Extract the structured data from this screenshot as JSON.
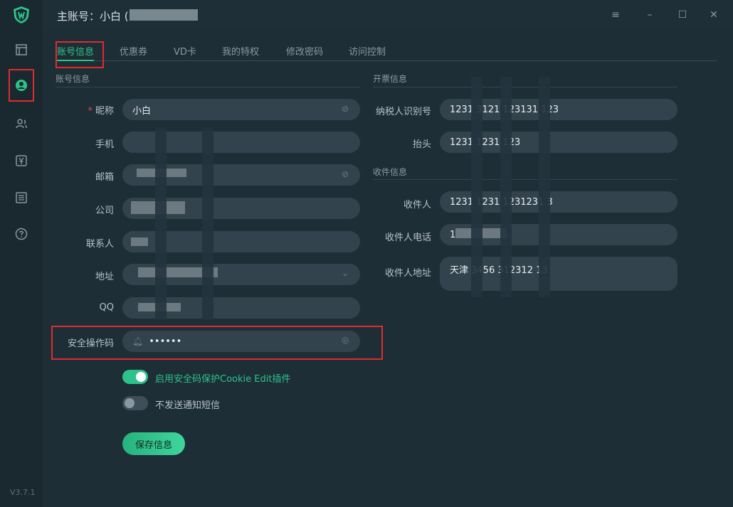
{
  "titlebar": {
    "title": "主账号：小白 ("
  },
  "version": "V3.7.1",
  "sidebar": {
    "items": [
      {
        "icon": "dashboard-icon"
      },
      {
        "icon": "user-circle-icon",
        "active": true
      },
      {
        "icon": "users-icon"
      },
      {
        "icon": "yen-icon"
      },
      {
        "icon": "list-icon"
      },
      {
        "icon": "help-icon"
      }
    ]
  },
  "tabs": [
    {
      "label": "账号信息",
      "active": true
    },
    {
      "label": "优惠券"
    },
    {
      "label": "VD卡"
    },
    {
      "label": "我的特权"
    },
    {
      "label": "修改密码"
    },
    {
      "label": "访问控制"
    }
  ],
  "account": {
    "section_title": "账号信息",
    "nickname_label": "昵称",
    "nickname_value": "小白",
    "phone_label": "手机",
    "email_label": "邮箱",
    "company_label": "公司",
    "contact_label": "联系人",
    "address_label": "地址",
    "qq_label": "QQ",
    "security_code_label": "安全操作码",
    "security_code_value": "••••••"
  },
  "invoice": {
    "section_title": "开票信息",
    "tax_id_label": "纳税人识别号",
    "tax_id_value": "1231  3121  123131  123",
    "header_label": "抬头",
    "header_value": "1231  1231  123"
  },
  "receiver": {
    "section_title": "收件信息",
    "name_label": "收件人",
    "name_value": "1231  1231  1231231  3",
    "phone_label": "收件人电话",
    "phone_value": "1",
    "address_label": "收件人地址",
    "address_value": "天津  3456  312312  13"
  },
  "toggles": {
    "cookie_edit_label": "启用安全码保护Cookie Edit插件",
    "cookie_edit_on": true,
    "no_sms_label": "不发送通知短信",
    "no_sms_on": false
  },
  "save_button_label": "保存信息",
  "colors": {
    "accent": "#2ec28a",
    "highlight_box": "#e02b2b"
  }
}
